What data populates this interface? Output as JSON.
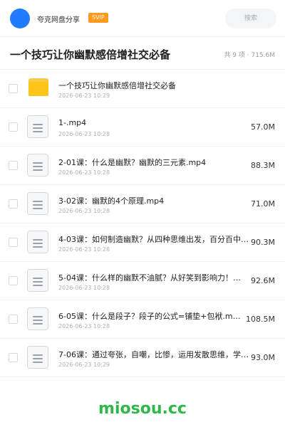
{
  "header": {
    "share_name": "夸克网盘分享",
    "vip_label": "SVIP",
    "search_placeholder": "搜索"
  },
  "folder": {
    "title": "一个技巧让你幽默感倍增社交必备",
    "summary": "共 9 项 · 715.6M"
  },
  "files": [
    {
      "type": "folder",
      "name": "一个技巧让你幽默感倍增社交必备",
      "date": "2026-06-23 10:29",
      "size": ""
    },
    {
      "type": "file",
      "name": "1-.mp4",
      "date": "2026-06-23 10:28",
      "size": "57.0M"
    },
    {
      "type": "file",
      "name": "2-01课：什么是幽默？幽默的三元素.mp4",
      "date": "2026-06-23 10:28",
      "size": "88.3M"
    },
    {
      "type": "file",
      "name": "3-02课：幽默的4个原理.mp4",
      "date": "2026-06-23 10:28",
      "size": "71.0M"
    },
    {
      "type": "file",
      "name": "4-03课：如何制造幽默？从四种思维出发，百分百中…",
      "date": "2026-06-23 10:28",
      "size": "90.3M"
    },
    {
      "type": "file",
      "name": "5-04课：什么样的幽默不油腻？从好笑到影响力！…",
      "date": "2026-06-23 10:28",
      "size": "92.6M"
    },
    {
      "type": "file",
      "name": "6-05课：什么是段子？段子的公式=铺垫+包袱.m…",
      "date": "2026-06-23 10:28",
      "size": "108.5M"
    },
    {
      "type": "file",
      "name": "7-06课：通过夸张，自嘲，比惨，运用发散思维，学…",
      "date": "2026-06-23 10:29",
      "size": "93.0M"
    }
  ],
  "watermark": "miosou.cc"
}
